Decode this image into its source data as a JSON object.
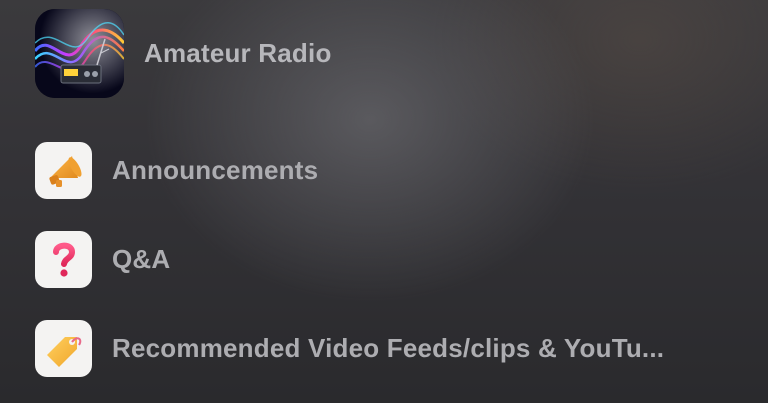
{
  "header": {
    "title": "Amateur Radio",
    "icon": "amateur-radio-logo"
  },
  "channels": [
    {
      "label": "Announcements",
      "icon": "megaphone-icon"
    },
    {
      "label": "Q&A",
      "icon": "question-mark-icon"
    },
    {
      "label": "Recommended Video Feeds/clips & YouTu...",
      "icon": "tag-icon"
    }
  ]
}
